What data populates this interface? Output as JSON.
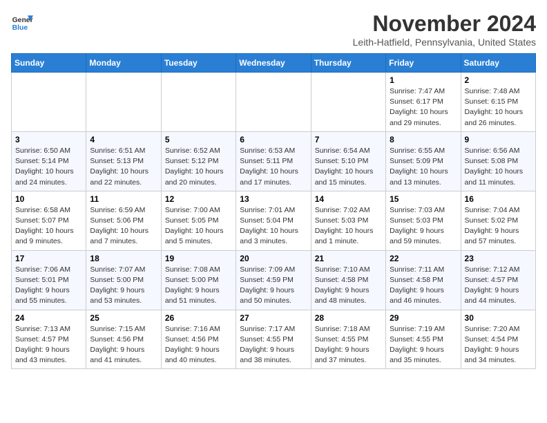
{
  "logo": {
    "line1": "General",
    "line2": "Blue"
  },
  "title": "November 2024",
  "location": "Leith-Hatfield, Pennsylvania, United States",
  "weekdays": [
    "Sunday",
    "Monday",
    "Tuesday",
    "Wednesday",
    "Thursday",
    "Friday",
    "Saturday"
  ],
  "weeks": [
    [
      {
        "day": "",
        "info": ""
      },
      {
        "day": "",
        "info": ""
      },
      {
        "day": "",
        "info": ""
      },
      {
        "day": "",
        "info": ""
      },
      {
        "day": "",
        "info": ""
      },
      {
        "day": "1",
        "info": "Sunrise: 7:47 AM\nSunset: 6:17 PM\nDaylight: 10 hours and 29 minutes."
      },
      {
        "day": "2",
        "info": "Sunrise: 7:48 AM\nSunset: 6:15 PM\nDaylight: 10 hours and 26 minutes."
      }
    ],
    [
      {
        "day": "3",
        "info": "Sunrise: 6:50 AM\nSunset: 5:14 PM\nDaylight: 10 hours and 24 minutes."
      },
      {
        "day": "4",
        "info": "Sunrise: 6:51 AM\nSunset: 5:13 PM\nDaylight: 10 hours and 22 minutes."
      },
      {
        "day": "5",
        "info": "Sunrise: 6:52 AM\nSunset: 5:12 PM\nDaylight: 10 hours and 20 minutes."
      },
      {
        "day": "6",
        "info": "Sunrise: 6:53 AM\nSunset: 5:11 PM\nDaylight: 10 hours and 17 minutes."
      },
      {
        "day": "7",
        "info": "Sunrise: 6:54 AM\nSunset: 5:10 PM\nDaylight: 10 hours and 15 minutes."
      },
      {
        "day": "8",
        "info": "Sunrise: 6:55 AM\nSunset: 5:09 PM\nDaylight: 10 hours and 13 minutes."
      },
      {
        "day": "9",
        "info": "Sunrise: 6:56 AM\nSunset: 5:08 PM\nDaylight: 10 hours and 11 minutes."
      }
    ],
    [
      {
        "day": "10",
        "info": "Sunrise: 6:58 AM\nSunset: 5:07 PM\nDaylight: 10 hours and 9 minutes."
      },
      {
        "day": "11",
        "info": "Sunrise: 6:59 AM\nSunset: 5:06 PM\nDaylight: 10 hours and 7 minutes."
      },
      {
        "day": "12",
        "info": "Sunrise: 7:00 AM\nSunset: 5:05 PM\nDaylight: 10 hours and 5 minutes."
      },
      {
        "day": "13",
        "info": "Sunrise: 7:01 AM\nSunset: 5:04 PM\nDaylight: 10 hours and 3 minutes."
      },
      {
        "day": "14",
        "info": "Sunrise: 7:02 AM\nSunset: 5:03 PM\nDaylight: 10 hours and 1 minute."
      },
      {
        "day": "15",
        "info": "Sunrise: 7:03 AM\nSunset: 5:03 PM\nDaylight: 9 hours and 59 minutes."
      },
      {
        "day": "16",
        "info": "Sunrise: 7:04 AM\nSunset: 5:02 PM\nDaylight: 9 hours and 57 minutes."
      }
    ],
    [
      {
        "day": "17",
        "info": "Sunrise: 7:06 AM\nSunset: 5:01 PM\nDaylight: 9 hours and 55 minutes."
      },
      {
        "day": "18",
        "info": "Sunrise: 7:07 AM\nSunset: 5:00 PM\nDaylight: 9 hours and 53 minutes."
      },
      {
        "day": "19",
        "info": "Sunrise: 7:08 AM\nSunset: 5:00 PM\nDaylight: 9 hours and 51 minutes."
      },
      {
        "day": "20",
        "info": "Sunrise: 7:09 AM\nSunset: 4:59 PM\nDaylight: 9 hours and 50 minutes."
      },
      {
        "day": "21",
        "info": "Sunrise: 7:10 AM\nSunset: 4:58 PM\nDaylight: 9 hours and 48 minutes."
      },
      {
        "day": "22",
        "info": "Sunrise: 7:11 AM\nSunset: 4:58 PM\nDaylight: 9 hours and 46 minutes."
      },
      {
        "day": "23",
        "info": "Sunrise: 7:12 AM\nSunset: 4:57 PM\nDaylight: 9 hours and 44 minutes."
      }
    ],
    [
      {
        "day": "24",
        "info": "Sunrise: 7:13 AM\nSunset: 4:57 PM\nDaylight: 9 hours and 43 minutes."
      },
      {
        "day": "25",
        "info": "Sunrise: 7:15 AM\nSunset: 4:56 PM\nDaylight: 9 hours and 41 minutes."
      },
      {
        "day": "26",
        "info": "Sunrise: 7:16 AM\nSunset: 4:56 PM\nDaylight: 9 hours and 40 minutes."
      },
      {
        "day": "27",
        "info": "Sunrise: 7:17 AM\nSunset: 4:55 PM\nDaylight: 9 hours and 38 minutes."
      },
      {
        "day": "28",
        "info": "Sunrise: 7:18 AM\nSunset: 4:55 PM\nDaylight: 9 hours and 37 minutes."
      },
      {
        "day": "29",
        "info": "Sunrise: 7:19 AM\nSunset: 4:55 PM\nDaylight: 9 hours and 35 minutes."
      },
      {
        "day": "30",
        "info": "Sunrise: 7:20 AM\nSunset: 4:54 PM\nDaylight: 9 hours and 34 minutes."
      }
    ]
  ]
}
